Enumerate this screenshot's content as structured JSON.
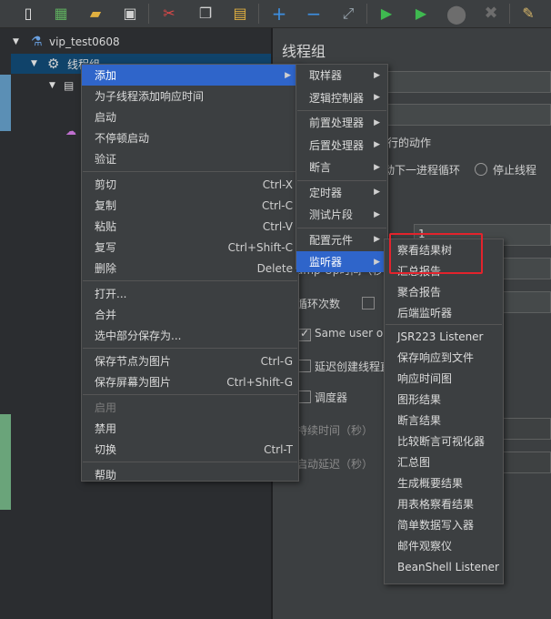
{
  "toolbar": {
    "icons": [
      "new-icon",
      "templates-icon",
      "open-icon",
      "save-icon",
      "cut-icon",
      "copy-icon",
      "paste-icon",
      "expand-icon",
      "collapse-icon",
      "toggle-icon",
      "start-icon",
      "start-no-pause-icon",
      "stop-icon",
      "shutdown-icon",
      "clear-icon"
    ]
  },
  "tree": {
    "root": "vip_test0608",
    "thread_group": "线程组"
  },
  "panel": {
    "title": "线程组",
    "action_header": "行的动作",
    "radio_next_loop": "动下一进程循环",
    "radio_stop_thread": "停止线程",
    "threads_value": "1",
    "ramp_label": "amp-Up时间（秒",
    "loop_label": "循环次数",
    "same_user": "Same user on",
    "delay_create": "延迟创建线程直",
    "scheduler": "调度器",
    "duration": "持续时间（秒）",
    "startup_delay": "启动延迟（秒）"
  },
  "context_menu": [
    {
      "label": "添加",
      "arrow": "▶",
      "state": "selected"
    },
    {
      "label": "为子线程添加响应时间"
    },
    {
      "label": "启动"
    },
    {
      "label": "不停顿启动"
    },
    {
      "label": "验证"
    },
    {
      "sep": true
    },
    {
      "label": "剪切",
      "shortcut": "Ctrl-X"
    },
    {
      "label": "复制",
      "shortcut": "Ctrl-C"
    },
    {
      "label": "粘贴",
      "shortcut": "Ctrl-V"
    },
    {
      "label": "复写",
      "shortcut": "Ctrl+Shift-C"
    },
    {
      "label": "删除",
      "shortcut": "Delete"
    },
    {
      "sep": true
    },
    {
      "label": "打开..."
    },
    {
      "label": "合并"
    },
    {
      "label": "选中部分保存为..."
    },
    {
      "sep": true
    },
    {
      "label": "保存节点为图片",
      "shortcut": "Ctrl-G"
    },
    {
      "label": "保存屏幕为图片",
      "shortcut": "Ctrl+Shift-G"
    },
    {
      "sep": true
    },
    {
      "label": "启用",
      "state": "disabled"
    },
    {
      "label": "禁用"
    },
    {
      "label": "切换",
      "shortcut": "Ctrl-T"
    },
    {
      "sep": true
    },
    {
      "label": "帮助"
    }
  ],
  "add_submenu": [
    {
      "label": "取样器",
      "arrow": "▶"
    },
    {
      "label": "逻辑控制器",
      "arrow": "▶"
    },
    {
      "sep": true
    },
    {
      "label": "前置处理器",
      "arrow": "▶"
    },
    {
      "label": "后置处理器",
      "arrow": "▶"
    },
    {
      "label": "断言",
      "arrow": "▶"
    },
    {
      "sep": true
    },
    {
      "label": "定时器",
      "arrow": "▶"
    },
    {
      "label": "测试片段",
      "arrow": "▶"
    },
    {
      "sep": true
    },
    {
      "label": "配置元件",
      "arrow": "▶"
    },
    {
      "label": "监听器",
      "arrow": "▶",
      "state": "selected"
    }
  ],
  "listener_submenu": [
    {
      "label": "察看结果树",
      "highlight": true
    },
    {
      "label": "汇总报告"
    },
    {
      "label": "聚合报告"
    },
    {
      "label": "后端监听器"
    },
    {
      "sep": true
    },
    {
      "label": "JSR223 Listener"
    },
    {
      "label": "保存响应到文件"
    },
    {
      "label": "响应时间图"
    },
    {
      "label": "图形结果"
    },
    {
      "label": "断言结果"
    },
    {
      "label": "比较断言可视化器"
    },
    {
      "label": "汇总图"
    },
    {
      "label": "生成概要结果"
    },
    {
      "label": "用表格察看结果"
    },
    {
      "label": "简单数据写入器"
    },
    {
      "label": "邮件观察仪"
    },
    {
      "label": "BeanShell Listener"
    }
  ]
}
